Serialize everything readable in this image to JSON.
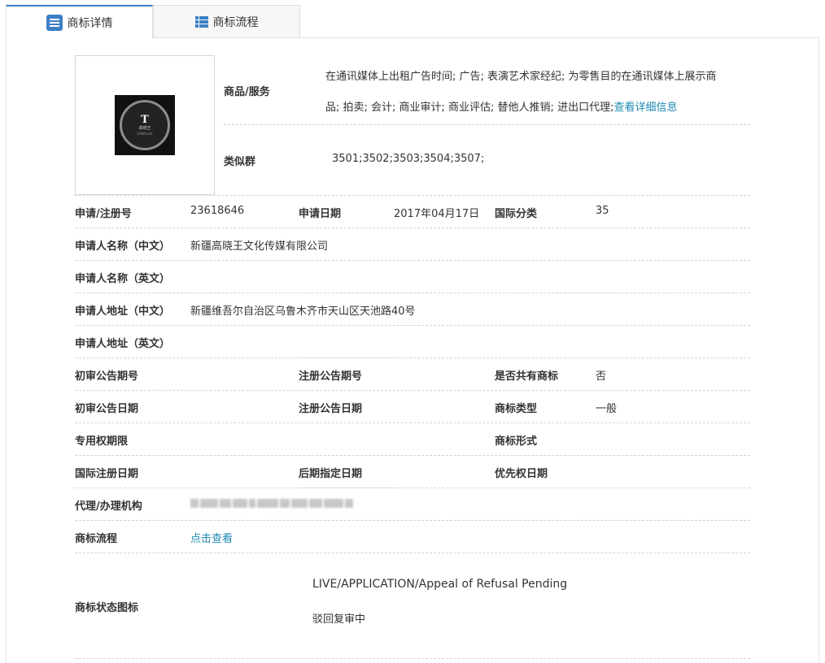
{
  "tabs": [
    {
      "label": "商标详情",
      "icon": "list-icon",
      "active": true
    },
    {
      "label": "商标流程",
      "icon": "process-icon",
      "active": false
    }
  ],
  "logo": {
    "mark_text": "T",
    "sub_text": "高晓王",
    "sub_text2": "GXW.com"
  },
  "goods": {
    "label": "商品/服务",
    "line1": "在通讯媒体上出租广告时间; 广告; 表演艺术家经纪; 为零售目的在通讯媒体上展示商",
    "line2": "品; 拍卖; 会计; 商业审计; 商业评估; 替他人推销; 进出口代理;",
    "detail_link": "查看详细信息"
  },
  "similar": {
    "label": "类似群",
    "value": "3501;3502;3503;3504;3507;"
  },
  "rows": {
    "reg_no_label": "申请/注册号",
    "reg_no": "23618646",
    "apply_date_label": "申请日期",
    "apply_date": "2017年04月17日",
    "intl_class_label": "国际分类",
    "intl_class": "35",
    "applicant_cn_label": "申请人名称（中文）",
    "applicant_cn": "新疆高晓王文化传媒有限公司",
    "applicant_en_label": "申请人名称（英文）",
    "address_cn_label": "申请人地址（中文）",
    "address_cn": "新疆维吾尔自治区乌鲁木齐市天山区天池路40号",
    "address_en_label": "申请人地址（英文）",
    "prelim_no_label": "初审公告期号",
    "reg_pub_no_label": "注册公告期号",
    "shared_label": "是否共有商标",
    "shared": "否",
    "prelim_date_label": "初审公告日期",
    "reg_pub_date_label": "注册公告日期",
    "mark_type_label": "商标类型",
    "mark_type": "一般",
    "exclusive_label": "专用权期限",
    "mark_form_label": "商标形式",
    "intl_reg_date_label": "国际注册日期",
    "late_designation_label": "后期指定日期",
    "priority_label": "优先权日期",
    "agent_label": "代理/办理机构",
    "flow_label": "商标流程",
    "flow_link": "点击查看",
    "status_label": "商标状态图标",
    "status_en": "LIVE/APPLICATION/Appeal of Refusal Pending",
    "status_cn": "驳回复审中"
  }
}
